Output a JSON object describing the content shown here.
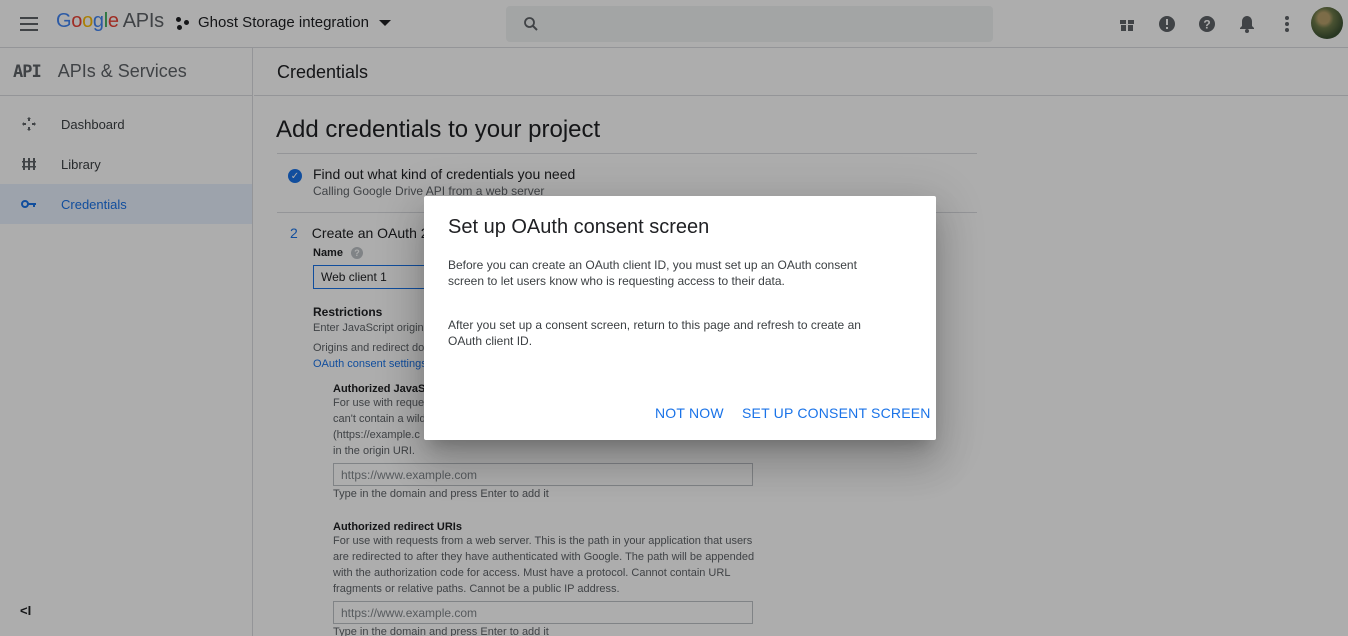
{
  "header": {
    "logo_google": [
      "G",
      "o",
      "o",
      "g",
      "l",
      "e"
    ],
    "logo_apis": "APIs",
    "project_name": "Ghost Storage integration",
    "icons": [
      "gift-icon",
      "feedback-icon",
      "help-icon",
      "notifications-icon",
      "more-vert-icon"
    ]
  },
  "sidebar": {
    "badge": "API",
    "title": "APIs & Services",
    "items": [
      {
        "label": "Dashboard",
        "icon": "dashboard-icon"
      },
      {
        "label": "Library",
        "icon": "library-icon"
      },
      {
        "label": "Credentials",
        "icon": "key-icon",
        "active": true
      }
    ],
    "collapse_glyph": "<I"
  },
  "content": {
    "header_title": "Credentials",
    "page_title": "Add credentials to your project",
    "step1_title": "Find out what kind of credentials you need",
    "step1_sub": "Calling Google Drive API from a web server",
    "step2_num": "2",
    "step2_title": "Create an OAuth 2",
    "name_label": "Name",
    "name_value": "Web client 1",
    "restrictions_title": "Restrictions",
    "restrictions_text1": "Enter JavaScript origin",
    "restrictions_text2": "Origins and redirect do",
    "oauth_link": "OAuth consent settings",
    "js_origins_title": "Authorized JavaSc",
    "js_origins_lines": [
      "For use with reque",
      "can't contain a wild",
      "(https://example.c",
      "in the origin URI."
    ],
    "js_origins_placeholder": "https://www.example.com",
    "js_origins_hint": "Type in the domain and press Enter to add it",
    "redirect_title": "Authorized redirect URIs",
    "redirect_lines": [
      "For use with requests from a web server. This is the path in your application that users",
      "are redirected to after they have authenticated with Google. The path will be appended",
      "with the authorization code for access. Must have a protocol. Cannot contain URL",
      "fragments or relative paths. Cannot be a public IP address."
    ],
    "redirect_placeholder": "https://www.example.com",
    "redirect_hint": "Type in the domain and press Enter to add it"
  },
  "dialog": {
    "title": "Set up OAuth consent screen",
    "para1_line1": "Before you can create an OAuth client ID, you must set up an OAuth consent",
    "para1_line2": "screen to let users know who is requesting access to their data.",
    "para2_line1": "After you set up a consent screen, return to this page and refresh to create an",
    "para2_line2": "OAuth client ID.",
    "btn_not_now": "NOT NOW",
    "btn_setup": "SET UP CONSENT SCREEN"
  },
  "colors": {
    "accent": "#1a73e8",
    "scrim": "rgba(0,0,0,0.32)"
  }
}
